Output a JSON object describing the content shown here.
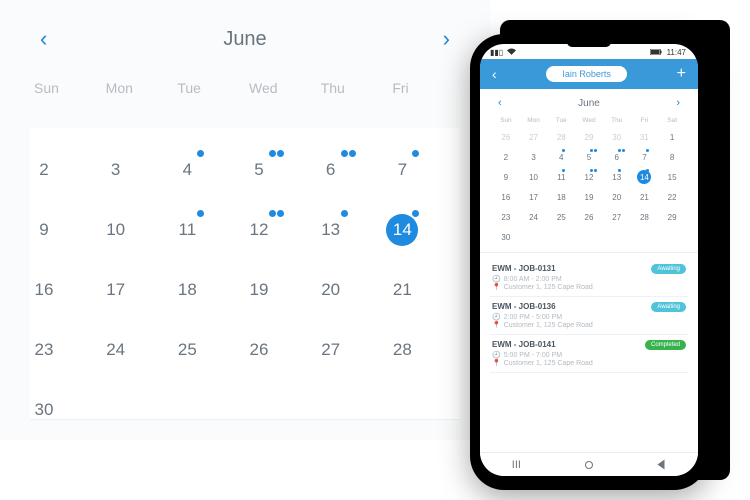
{
  "big_calendar": {
    "month": "June",
    "dow": [
      "Sun",
      "Mon",
      "Tue",
      "Wed",
      "Thu",
      "Fri"
    ],
    "weeks": [
      [
        {
          "n": 2
        },
        {
          "n": 3
        },
        {
          "n": 4,
          "dots": 1
        },
        {
          "n": 5,
          "dots": 2
        },
        {
          "n": 6,
          "dots": 2
        },
        {
          "n": 7,
          "dots": 1
        }
      ],
      [
        {
          "n": 9
        },
        {
          "n": 10
        },
        {
          "n": 11,
          "dots": 1
        },
        {
          "n": 12,
          "dots": 2
        },
        {
          "n": 13,
          "dots": 1
        },
        {
          "n": 14,
          "dots": 1,
          "sel": true
        }
      ],
      [
        {
          "n": 16
        },
        {
          "n": 17
        },
        {
          "n": 18
        },
        {
          "n": 19
        },
        {
          "n": 20
        },
        {
          "n": 21
        }
      ],
      [
        {
          "n": 23
        },
        {
          "n": 24
        },
        {
          "n": 25
        },
        {
          "n": 26
        },
        {
          "n": 27
        },
        {
          "n": 28
        }
      ],
      [
        {
          "n": 30
        },
        {},
        {},
        {},
        {},
        {}
      ]
    ]
  },
  "phone": {
    "status_time": "11:47",
    "user_name": "Iain Roberts",
    "calendar": {
      "month": "June",
      "dow": [
        "Sun",
        "Mon",
        "Tue",
        "Wed",
        "Thu",
        "Fri",
        "Sat"
      ],
      "weeks": [
        [
          {
            "n": 26,
            "prev": true
          },
          {
            "n": 27,
            "prev": true
          },
          {
            "n": 28,
            "prev": true
          },
          {
            "n": 29,
            "prev": true
          },
          {
            "n": 30,
            "prev": true
          },
          {
            "n": 31,
            "prev": true
          },
          {
            "n": 1
          }
        ],
        [
          {
            "n": 2
          },
          {
            "n": 3
          },
          {
            "n": 4,
            "dots": 1
          },
          {
            "n": 5,
            "dots": 2
          },
          {
            "n": 6,
            "dots": 2
          },
          {
            "n": 7,
            "dots": 1
          },
          {
            "n": 8
          }
        ],
        [
          {
            "n": 9
          },
          {
            "n": 10
          },
          {
            "n": 11,
            "dots": 1
          },
          {
            "n": 12,
            "dots": 2
          },
          {
            "n": 13,
            "dots": 1
          },
          {
            "n": 14,
            "dots": 1,
            "sel": true
          },
          {
            "n": 15
          }
        ],
        [
          {
            "n": 16
          },
          {
            "n": 17
          },
          {
            "n": 18
          },
          {
            "n": 19
          },
          {
            "n": 20
          },
          {
            "n": 21
          },
          {
            "n": 22
          }
        ],
        [
          {
            "n": 23
          },
          {
            "n": 24
          },
          {
            "n": 25
          },
          {
            "n": 26
          },
          {
            "n": 27
          },
          {
            "n": 28
          },
          {
            "n": 29
          }
        ],
        [
          {
            "n": 30
          },
          {},
          {},
          {},
          {},
          {},
          {}
        ]
      ]
    },
    "jobs": [
      {
        "id": "EWM - JOB-0131",
        "time": "8:00 AM - 2:00 PM",
        "loc": "Customer 1, 125 Cape Road",
        "status": "Awaiting",
        "status_type": "awaiting"
      },
      {
        "id": "EWM - JOB-0136",
        "time": "2:00 PM - 5:00 PM",
        "loc": "Customer 1, 125 Cape Road",
        "status": "Awaiting",
        "status_type": "awaiting"
      },
      {
        "id": "EWM - JOB-0141",
        "time": "5:00 PM - 7:00 PM",
        "loc": "Customer 1, 125 Cape Road",
        "status": "Completed",
        "status_type": "completed"
      }
    ]
  }
}
